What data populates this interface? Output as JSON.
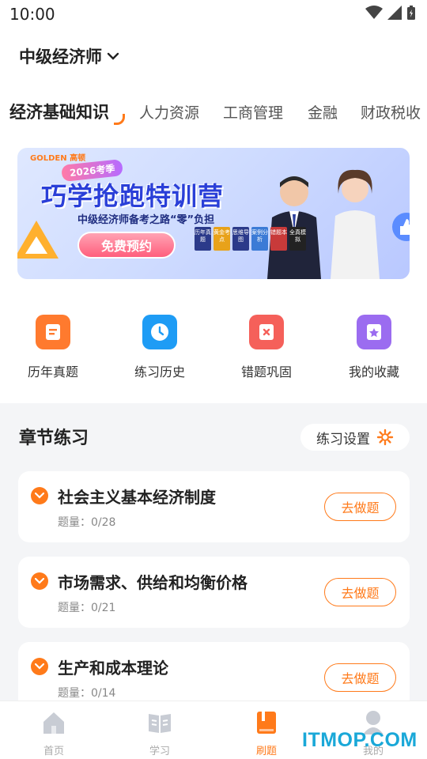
{
  "status_bar": {
    "time": "10:00"
  },
  "exam_selector": {
    "label": "中级经济师"
  },
  "subject_tabs": [
    {
      "label": "经济基础知识",
      "active": true
    },
    {
      "label": "人力资源",
      "active": false
    },
    {
      "label": "工商管理",
      "active": false
    },
    {
      "label": "金融",
      "active": false
    },
    {
      "label": "财政税收",
      "active": false
    }
  ],
  "banner": {
    "brand": "GOLDEN 高顿",
    "season": "2026考季",
    "title": "巧学抢跑特训营",
    "subtitle": "中级经济师备考之路“零”负担",
    "button": "免费预约",
    "books": [
      "历年真题",
      "黄金考点",
      "思维导图",
      "案例分析",
      "错题本",
      "全真模拟"
    ]
  },
  "quick_actions": [
    {
      "label": "历年真题",
      "icon": "document-icon",
      "color": "#ff7a2e"
    },
    {
      "label": "练习历史",
      "icon": "clock-icon",
      "color": "#1e9cf5"
    },
    {
      "label": "错题巩固",
      "icon": "error-book-icon",
      "color": "#f5605a"
    },
    {
      "label": "我的收藏",
      "icon": "star-bookmark-icon",
      "color": "#9b6cf0"
    }
  ],
  "chapter_section": {
    "title": "章节练习",
    "settings_label": "练习设置",
    "count_prefix": "题量：",
    "chapters": [
      {
        "title": "社会主义基本经济制度",
        "count": "题量：0/28",
        "button": "去做题"
      },
      {
        "title": "市场需求、供给和均衡价格",
        "count": "题量：0/21",
        "button": "去做题"
      },
      {
        "title": "生产和成本理论",
        "count": "题量：0/14",
        "button": "去做题"
      }
    ]
  },
  "bottom_nav": [
    {
      "label": "首页",
      "icon": "home-icon",
      "active": false
    },
    {
      "label": "学习",
      "icon": "open-book-icon",
      "active": false
    },
    {
      "label": "刷题",
      "icon": "practice-book-icon",
      "active": true
    },
    {
      "label": "我的",
      "icon": "profile-icon",
      "active": false
    }
  ],
  "watermark": "ITMOP.COM",
  "colors": {
    "accent": "#ff7a1a",
    "background": "#f4f5f7"
  }
}
